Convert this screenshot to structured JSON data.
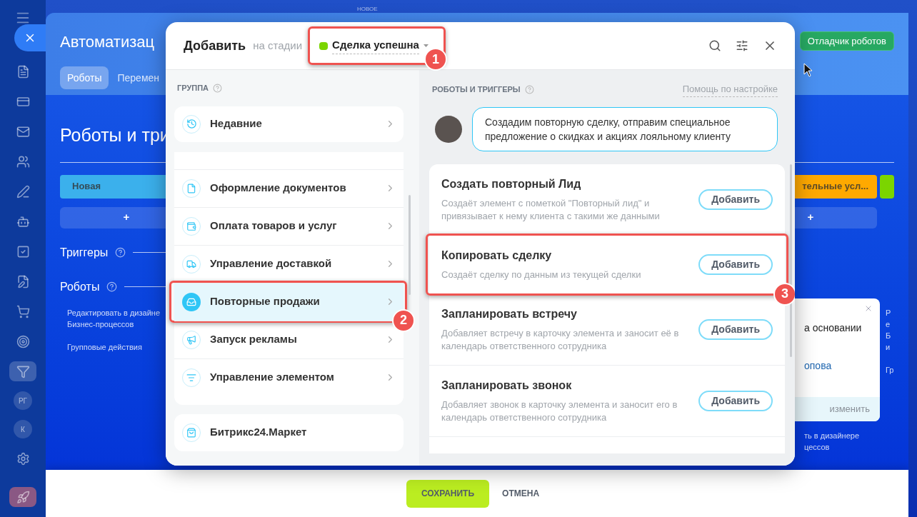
{
  "sidebar": {
    "items": [
      {
        "kind": "icon",
        "selected": false
      },
      {
        "kind": "icon",
        "selected": false
      },
      {
        "kind": "icon",
        "selected": false
      },
      {
        "kind": "icon",
        "selected": false
      },
      {
        "kind": "icon",
        "selected": false
      },
      {
        "kind": "icon",
        "selected": false
      },
      {
        "kind": "icon",
        "selected": false
      },
      {
        "kind": "icon",
        "selected": false
      },
      {
        "kind": "icon",
        "selected": false
      },
      {
        "kind": "icon",
        "selected": false
      },
      {
        "kind": "icon",
        "selected": true
      },
      {
        "kind": "avatar",
        "label": "РГ",
        "selected": false
      },
      {
        "kind": "avatar",
        "label": "К",
        "selected": false
      },
      {
        "kind": "icon",
        "selected": false
      },
      {
        "kind": "icon",
        "selected": false
      }
    ]
  },
  "top_label": "НОВОЕ",
  "page": {
    "title": "Автоматизац",
    "tabs": [
      {
        "label": "Роботы",
        "selected": true
      },
      {
        "label": "Перемен",
        "selected": false
      }
    ],
    "debug_button": "Отладчик роботов",
    "section_title": "Роботы и три",
    "stages": [
      {
        "label": "Новая",
        "color": "#3bb0ec"
      },
      {
        "label": "тельные усл...",
        "color": "#ffa900"
      },
      {
        "color": "#7bd500"
      }
    ],
    "add_buttons": [
      "+",
      "+"
    ],
    "triggers_label": "Триггеры",
    "robots_label": "Роботы",
    "left_links": [
      "Редактировать в дизайне Бизнес-процессов",
      "Групповые действия"
    ],
    "popup": {
      "text": "а основании",
      "link": "опова",
      "action": "изменить"
    },
    "right_link": "ть в дизайнере цессов",
    "far_right": [
      "Ре Би",
      "Гр"
    ]
  },
  "modal": {
    "title": "Добавить",
    "stage_prefix": "на стадии",
    "stage": {
      "label": "Сделка успешна",
      "color": "#7bd500",
      "callout": "1"
    },
    "groups_header": "ГРУППА",
    "pinned": {
      "label": "Недавние"
    },
    "groups": [
      {
        "label": "Оформление документов",
        "selected": false
      },
      {
        "label": "Оплата товаров и услуг",
        "selected": false
      },
      {
        "label": "Управление доставкой",
        "selected": false
      },
      {
        "label": "Повторные продажи",
        "selected": true,
        "callout": "2"
      },
      {
        "label": "Запуск рекламы",
        "selected": false
      },
      {
        "label": "Управление элементом",
        "selected": false
      }
    ],
    "market": "Битрикс24.Маркет",
    "robots_header": "РОБОТЫ И ТРИГГЕРЫ",
    "help_link": "Помощь по настройке",
    "tip": "Создадим повторную сделку, отправим специальное предложение о скидках и акциях лояльному клиенту",
    "robots": [
      {
        "title": "Создать повторный Лид",
        "description": "Создаёт элемент с пометкой \"Повторный лид\" и привязывает к нему клиента с такими же данными",
        "button": "Добавить"
      },
      {
        "title": "Копировать сделку",
        "description": "Создаёт сделку по данным из текущей сделки",
        "button": "Добавить",
        "callout": "3"
      },
      {
        "title": "Запланировать встречу",
        "description": "Добавляет встречу в карточку элемента и заносит её в календарь ответственного сотрудника",
        "button": "Добавить"
      },
      {
        "title": "Запланировать звонок",
        "description": "Добавляет звонок в карточку элемента и заносит его в календарь ответственного сотрудника",
        "button": "Добавить"
      }
    ]
  },
  "footer": {
    "save": "СОХРАНИТЬ",
    "cancel": "ОТМЕНА"
  }
}
